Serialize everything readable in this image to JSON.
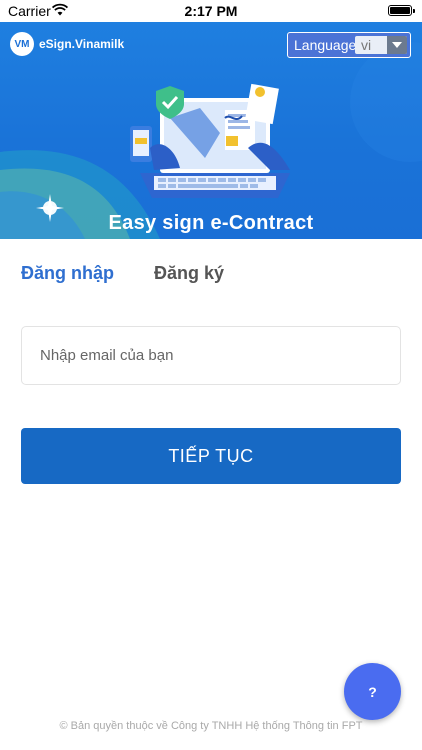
{
  "status_bar": {
    "carrier": "Carrier",
    "time": "2:17 PM"
  },
  "header": {
    "brand": "eSign.Vinamilk",
    "brand_mark": "VM",
    "language_label": "Language",
    "language_value": "vi"
  },
  "hero": {
    "title": "Easy sign e-Contract",
    "illustration": "laptop-contract-illustration"
  },
  "tabs": {
    "login": "Đăng nhập",
    "register": "Đăng ký",
    "active": "login"
  },
  "form": {
    "email_placeholder": "Nhập email của bạn",
    "email_value": ""
  },
  "actions": {
    "continue_label": "TIẾP TỤC",
    "help_label": "?"
  },
  "footer": {
    "copyright": "© Bản quyền thuộc về Công ty TNHH Hệ thống Thông tin FPT"
  },
  "colors": {
    "hero_blue": "#1a73d8",
    "active_tab": "#2f6fd0",
    "button": "#1769c4",
    "fab": "#4a6cf0"
  }
}
